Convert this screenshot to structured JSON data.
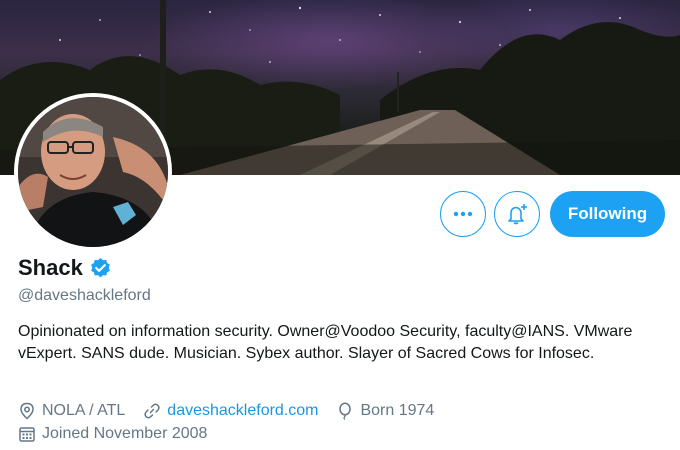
{
  "profile": {
    "display_name": "Shack",
    "verified": true,
    "handle": "@daveshackleford",
    "bio": "Opinionated on information security. Owner@Voodoo Security, faculty@IANS. VMware vExpert. SANS dude. Musician. Sybex author. Slayer of Sacred Cows for Infosec.",
    "location": "NOLA / ATL",
    "website": "daveshackleford.com",
    "birthday": "Born 1974",
    "joined": "Joined November 2008"
  },
  "actions": {
    "more_icon": "more-dots-icon",
    "notify_icon": "bell-plus-icon",
    "following_label": "Following"
  },
  "colors": {
    "accent": "#1da1f2",
    "link": "#1b95e0",
    "secondary_text": "#657786",
    "primary_text": "#14171a"
  },
  "icons": {
    "location": "location-pin-icon",
    "website": "link-icon",
    "birthday": "balloon-icon",
    "joined": "calendar-icon",
    "verified": "verified-badge-icon"
  }
}
